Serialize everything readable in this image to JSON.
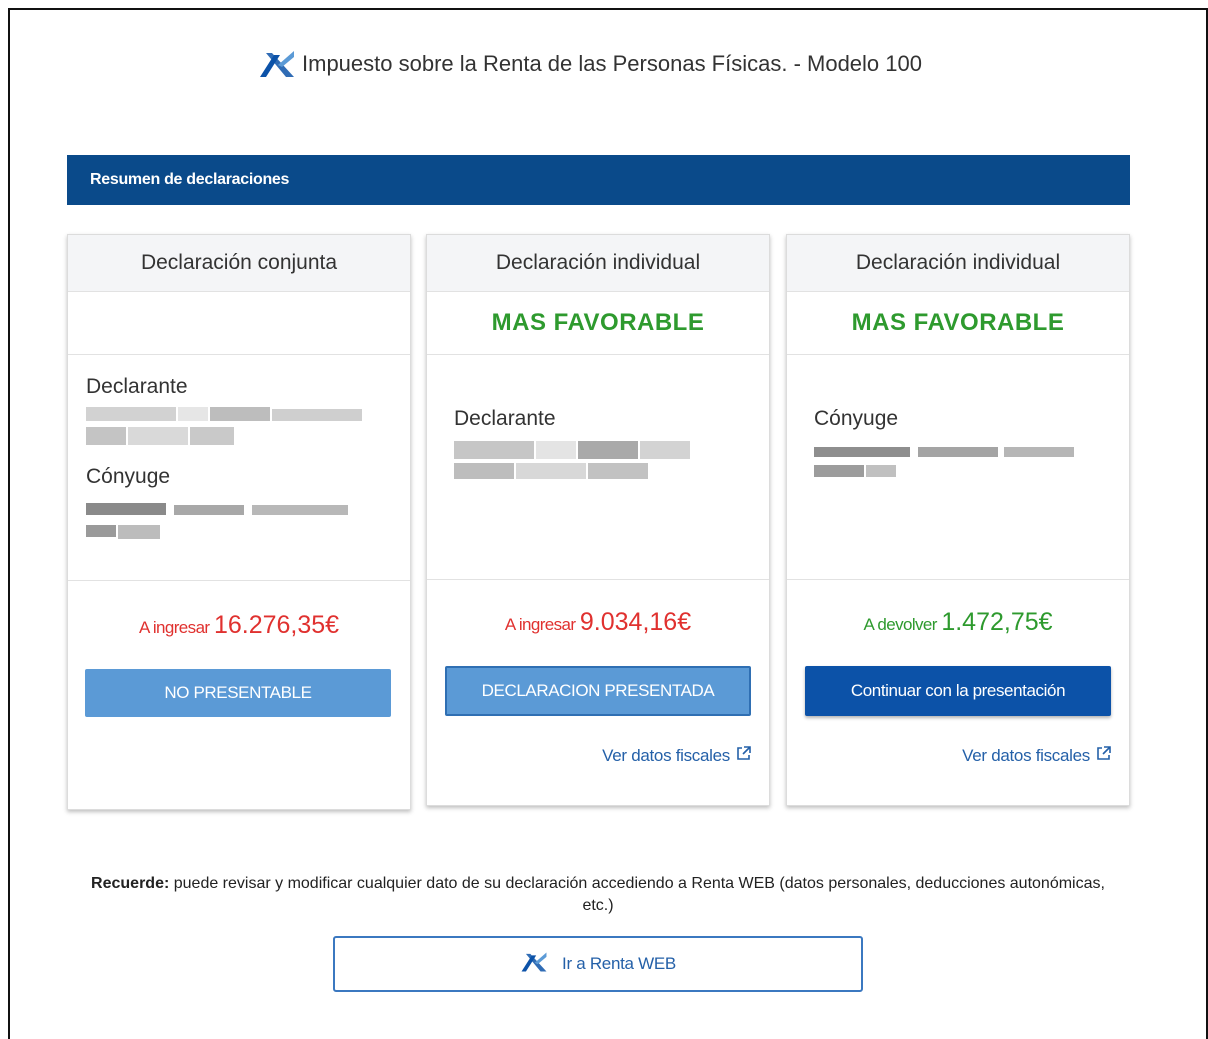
{
  "header": {
    "title": "Impuesto sobre la Renta de las Personas Físicas. - Modelo 100",
    "logo_icon": "aeat-logo-icon"
  },
  "section": {
    "title": "Resumen de declaraciones"
  },
  "colors": {
    "bar": "#0a4a8a",
    "favorable_green": "#2e9a2e",
    "pay_red": "#e0312f",
    "button_light": "#5b9ad6",
    "button_dark": "#0c52a8",
    "link_blue": "#2460a8"
  },
  "cards": [
    {
      "title": "Declaración conjunta",
      "favorable": "",
      "roles": [
        "Declarante",
        "Cónyuge"
      ],
      "result_prefix": "A ingresar",
      "result_amount": "16.276,35€",
      "button_label": "NO PRESENTABLE",
      "link_label": ""
    },
    {
      "title": "Declaración individual",
      "favorable": "MAS FAVORABLE",
      "roles": [
        "Declarante"
      ],
      "result_prefix": "A ingresar",
      "result_amount": "9.034,16€",
      "button_label": "DECLARACION PRESENTADA",
      "link_label": "Ver datos fiscales"
    },
    {
      "title": "Declaración individual",
      "favorable": "MAS FAVORABLE",
      "roles": [
        "Cónyuge"
      ],
      "result_prefix": "A devolver",
      "result_amount": "1.472,75€",
      "button_label": "Continuar con la presentación",
      "link_label": "Ver datos fiscales"
    }
  ],
  "reminder": {
    "bold": "Recuerde:",
    "text": " puede revisar y modificar cualquier dato de su declaración accediendo a Renta WEB (datos personales, deducciones autonómicas, etc.)"
  },
  "renta_button": {
    "label": "Ir a Renta WEB"
  }
}
